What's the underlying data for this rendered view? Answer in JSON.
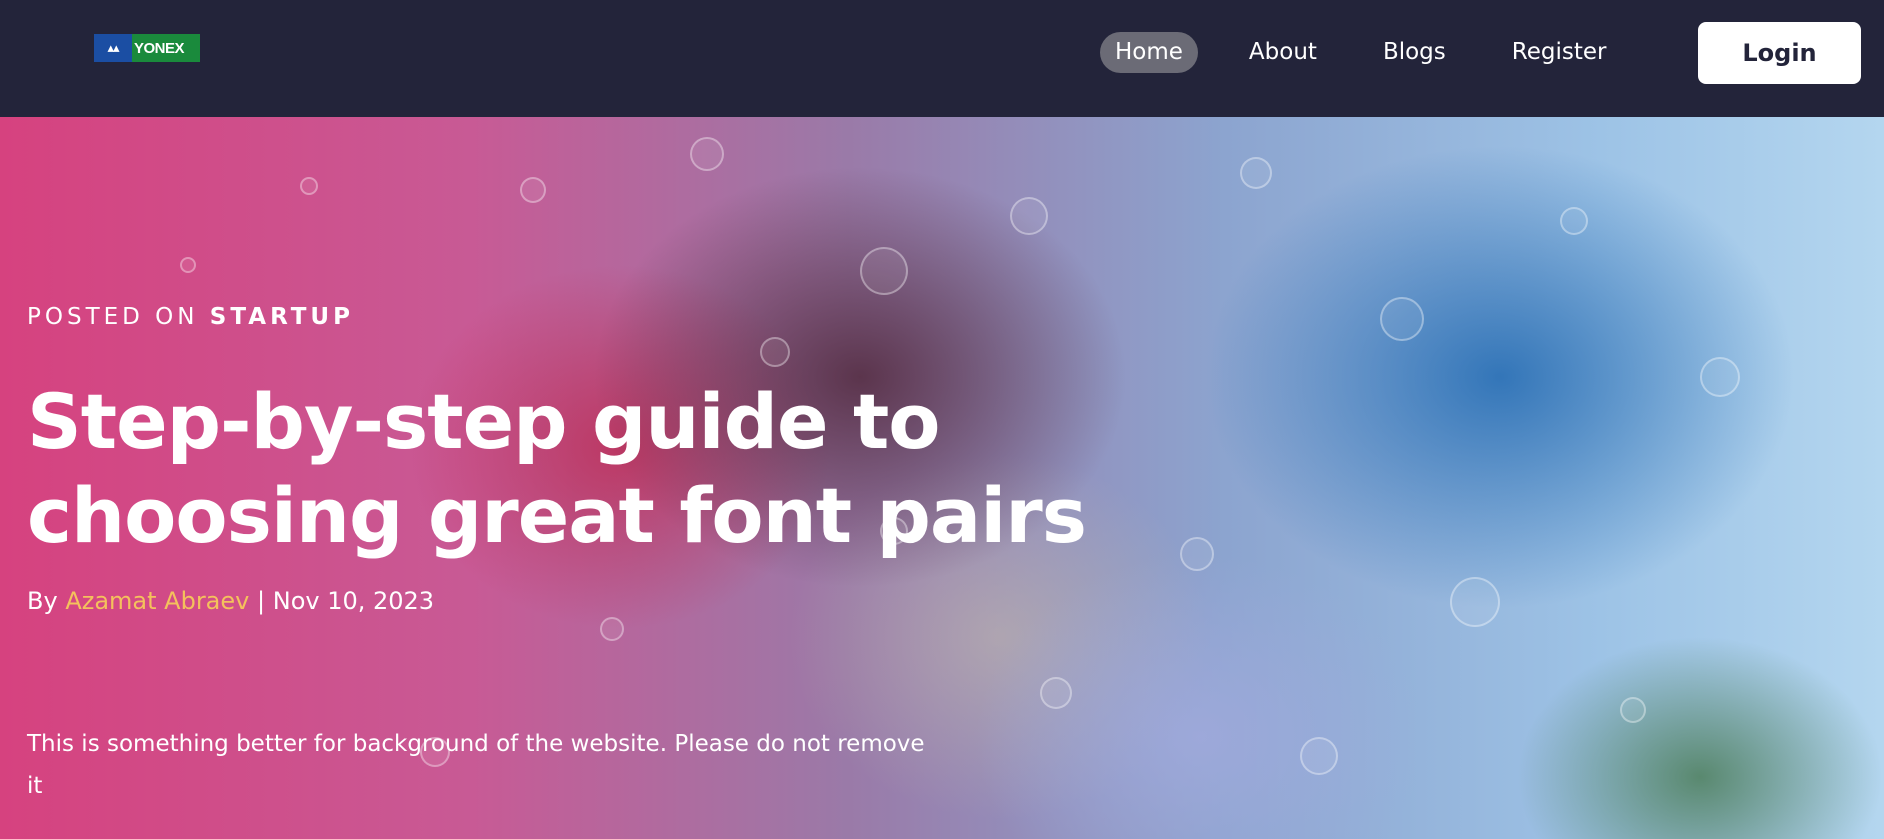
{
  "nav": {
    "logo_text": "YONEX",
    "links": [
      {
        "label": "Home",
        "active": true
      },
      {
        "label": "About",
        "active": false
      },
      {
        "label": "Blogs",
        "active": false
      },
      {
        "label": "Register",
        "active": false
      }
    ],
    "login_label": "Login"
  },
  "hero": {
    "posted_prefix": "POSTED ON",
    "category": "STARTUP",
    "title": "Step-by-step guide to choosing great font pairs",
    "byline_prefix": "By",
    "author": "Azamat Abraev",
    "separator": "|",
    "date": "Nov 10, 2023",
    "note": "This is something better for background of the website. Please do not remove it"
  },
  "colors": {
    "nav_background": "#23243a",
    "active_pill": "#6b6b76",
    "author_link": "#f4c15c",
    "login_button_bg": "#ffffff"
  },
  "icons": {
    "logo": "yonex-logo-icon"
  }
}
